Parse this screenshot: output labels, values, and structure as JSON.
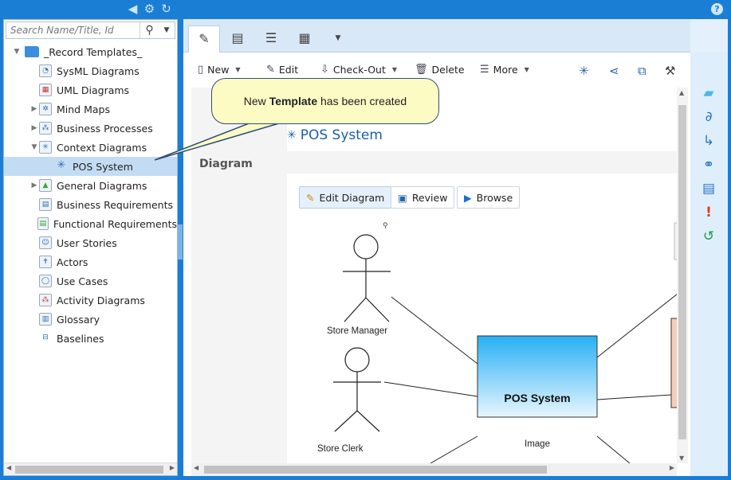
{
  "header": {
    "icons": [
      "back-icon",
      "gear-icon",
      "refresh-icon"
    ],
    "help_label": "?"
  },
  "search": {
    "placeholder": "Search Name/Title, Id",
    "button_glyph": "⚲",
    "dropdown_glyph": "▼"
  },
  "tree": {
    "root_label": "_Record Templates_",
    "items": [
      {
        "label": "SysML Diagrams"
      },
      {
        "label": "UML Diagrams"
      },
      {
        "label": "Mind Maps"
      },
      {
        "label": "Business Processes"
      },
      {
        "label": "Context Diagrams"
      },
      {
        "label": "POS System"
      },
      {
        "label": "General Diagrams"
      },
      {
        "label": "Business Requirements"
      },
      {
        "label": "Functional Requirements"
      },
      {
        "label": "User Stories"
      },
      {
        "label": "Actors"
      },
      {
        "label": "Use Cases"
      },
      {
        "label": "Activity Diagrams"
      },
      {
        "label": "Glossary"
      },
      {
        "label": "Baselines"
      }
    ]
  },
  "toolbar": {
    "new_label": "New",
    "edit_label": "Edit",
    "checkout_label": "Check-Out",
    "delete_label": "Delete",
    "more_label": "More"
  },
  "doc": {
    "title": "POS System",
    "section_label": "Diagram",
    "edit_diagram_label": "Edit Diagram",
    "review_label": "Review",
    "browse_label": "Browse"
  },
  "diagram": {
    "actor_store_manager": "Store Manager",
    "actor_store_clerk": "Store Clerk",
    "system_box_label": "POS System",
    "system_box_caption": "Image"
  },
  "callout": {
    "prefix": "New",
    "bold": "Template",
    "suffix": "has been created"
  },
  "colors": {
    "app_blue": "#1a7fd4",
    "selection": "#c3dcf3",
    "callout_fill": "#fdfbc4",
    "link_blue": "#1b5fa8"
  }
}
